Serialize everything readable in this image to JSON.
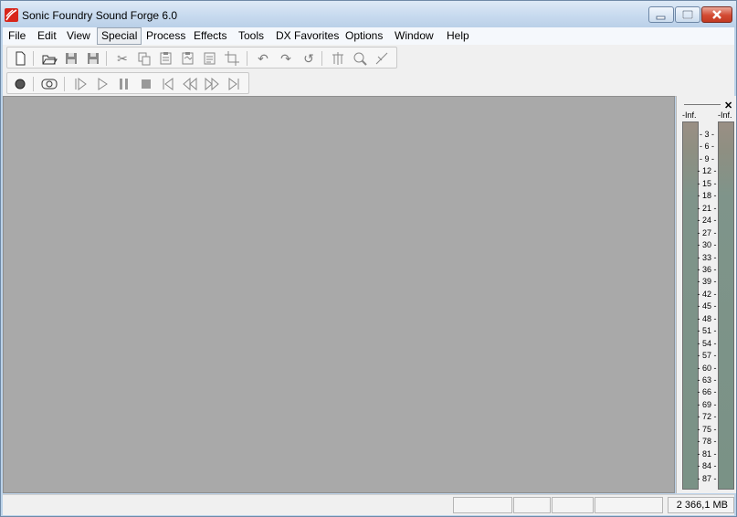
{
  "app": {
    "title": "Sonic Foundry Sound Forge 6.0"
  },
  "window_controls": {
    "minimize": "minimize",
    "maximize": "maximize",
    "close": "close"
  },
  "menu": [
    "File",
    "Edit",
    "View",
    "Special",
    "Process",
    "Effects",
    "Tools",
    "DX Favorites",
    "Options",
    "Window",
    "Help"
  ],
  "menu_active": "Special",
  "toolbar1": [
    "new-file-icon",
    "open-folder-icon",
    "save-icon",
    "save-all-icon",
    "cut-icon",
    "copy-icon",
    "paste-icon",
    "paste-special-icon",
    "mix-icon",
    "crop-icon",
    "undo-icon",
    "redo-icon",
    "repeat-icon",
    "trim-icon",
    "zoom-icon",
    "edit-tool-icon"
  ],
  "toolbar2": [
    "record-icon",
    "loop-play-icon",
    "play-all-icon",
    "play-icon",
    "pause-icon",
    "stop-icon",
    "go-to-start-icon",
    "rewind-icon",
    "forward-icon",
    "go-to-end-icon"
  ],
  "meters": {
    "left_label": "-Inf.",
    "right_label": "-Inf.",
    "scale": [
      "3",
      "6",
      "9",
      "12",
      "15",
      "18",
      "21",
      "24",
      "27",
      "30",
      "33",
      "36",
      "39",
      "42",
      "45",
      "48",
      "51",
      "54",
      "57",
      "60",
      "63",
      "66",
      "69",
      "72",
      "75",
      "78",
      "81",
      "84",
      "87"
    ]
  },
  "status": {
    "memory": "2 366,1 MB"
  },
  "colors": {
    "workspace": "#a9a9a9",
    "meter_bar": "#7a9286",
    "app_icon": "#d8261b",
    "close_button": "#c9452d"
  }
}
